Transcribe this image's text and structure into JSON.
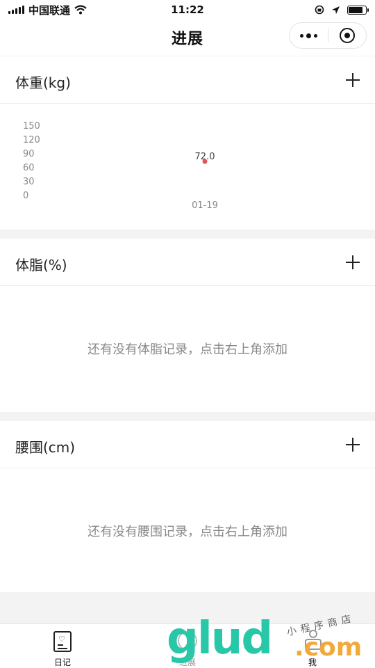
{
  "status_bar": {
    "carrier": "中国联通",
    "time": "11:22",
    "battery_level": 0.85
  },
  "nav": {
    "title": "进展"
  },
  "sections": {
    "weight": {
      "title": "体重(kg)",
      "empty_text": ""
    },
    "body_fat": {
      "title": "体脂(%)",
      "empty_text": "还有没有体脂记录，点击右上角添加"
    },
    "waist": {
      "title": "腰围(cm)",
      "empty_text": "还有没有腰围记录，点击右上角添加"
    }
  },
  "chart_data": {
    "type": "scatter",
    "title": "",
    "xlabel": "",
    "ylabel": "",
    "x": [
      "01-19"
    ],
    "values": [
      72.0
    ],
    "data_labels": [
      "72.0"
    ],
    "y_ticks": [
      "150",
      "120",
      "90",
      "60",
      "30",
      "0"
    ],
    "ylim": [
      0,
      150
    ],
    "grid": false,
    "point_color": "#e2565b"
  },
  "tabbar": {
    "tabs": [
      {
        "label": "日记"
      },
      {
        "label": "进展"
      },
      {
        "label": "我"
      }
    ]
  },
  "watermark": {
    "main": "glud",
    "suffix": ".com",
    "small": "小程序商店"
  }
}
